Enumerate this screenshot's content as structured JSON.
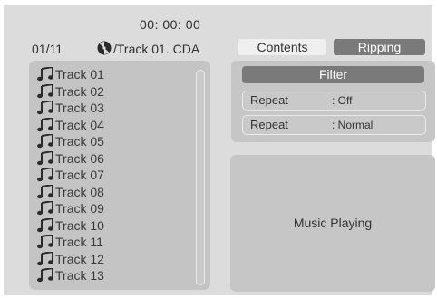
{
  "header": {
    "time": "00: 00: 00",
    "counter": "01/11",
    "disc_path": "/Track 01. CDA",
    "disc_icon": "disc-icon"
  },
  "tracks": [
    "Track  01",
    "Track  02",
    "Track  03",
    "Track  04",
    "Track  05",
    "Track  06",
    "Track  07",
    "Track  08",
    "Track  09",
    "Track  10",
    "Track  11",
    "Track  12",
    "Track  13"
  ],
  "track_icon": "music-note-icon",
  "tabs": {
    "contents": "Contents",
    "ripping": "Ripping"
  },
  "filter": "Filter",
  "settings": [
    {
      "label": "Repeat",
      "value": ": Off"
    },
    {
      "label": "Repeat",
      "value": ": Normal"
    }
  ],
  "status": "Music Playing",
  "colors": {
    "screen": "#dcdcdc",
    "panel": "#c6c6c6",
    "active_tab": "#7a7a7a"
  }
}
